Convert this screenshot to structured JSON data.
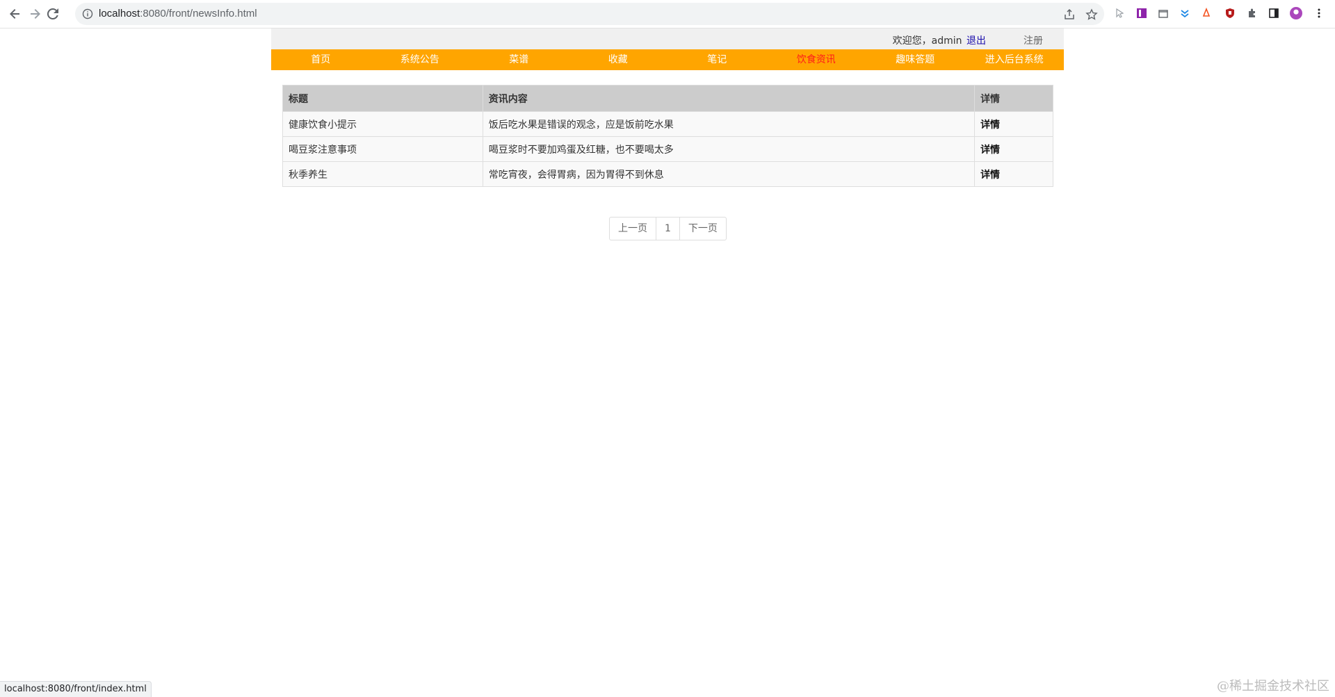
{
  "browser": {
    "url_host": "localhost",
    "url_rest": ":8080/front/newsInfo.html"
  },
  "header": {
    "welcome_prefix": "欢迎您，",
    "username": "admin",
    "logout_label": "退出",
    "register_label": "注册"
  },
  "nav": {
    "items": [
      {
        "label": "首页"
      },
      {
        "label": "系统公告"
      },
      {
        "label": "菜谱"
      },
      {
        "label": "收藏"
      },
      {
        "label": "笔记"
      },
      {
        "label": "饮食资讯"
      },
      {
        "label": "趣味答题"
      },
      {
        "label": "进入后台系统"
      }
    ],
    "active_color": "#ff1a1a",
    "bar_color": "#ffa500"
  },
  "table": {
    "headers": [
      "标题",
      "资讯内容",
      "详情"
    ],
    "rows": [
      {
        "title": "健康饮食小提示",
        "content": "饭后吃水果是错误的观念，应是饭前吃水果",
        "detail": "详情"
      },
      {
        "title": "喝豆浆注意事项",
        "content": "喝豆浆时不要加鸡蛋及红糖，也不要喝太多",
        "detail": "详情"
      },
      {
        "title": "秋季养生",
        "content": "常吃宵夜，会得胃病，因为胃得不到休息",
        "detail": "详情"
      }
    ]
  },
  "pager": {
    "prev_label": "上一页",
    "current_page": "1",
    "next_label": "下一页"
  },
  "status_bar": {
    "text": "localhost:8080/front/index.html"
  },
  "watermark": {
    "text": "@稀土掘金技术社区"
  }
}
